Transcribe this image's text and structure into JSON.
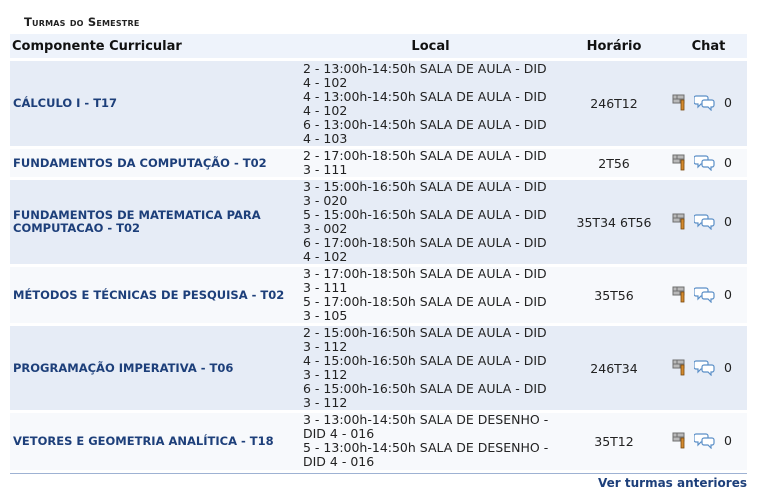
{
  "section_title": "Turmas do Semestre",
  "headers": {
    "componente": "Componente Curricular",
    "local": "Local",
    "horario": "Horário",
    "chat": "Chat"
  },
  "rows": [
    {
      "componente": "CÁLCULO I - T17",
      "local": [
        "2 - 13:00h-14:50h SALA DE AULA - DID",
        "4 - 102",
        "4 - 13:00h-14:50h SALA DE AULA - DID",
        "4 - 102",
        "6 - 13:00h-14:50h SALA DE AULA - DID",
        "4 - 103"
      ],
      "horario": "246T12",
      "chat_count": "0"
    },
    {
      "componente": "FUNDAMENTOS DA COMPUTAÇÃO - T02",
      "local": [
        "2 - 17:00h-18:50h SALA DE AULA - DID",
        "3 - 111"
      ],
      "horario": "2T56",
      "chat_count": "0"
    },
    {
      "componente": "FUNDAMENTOS DE MATEMATICA PARA COMPUTACAO - T02",
      "local": [
        "3 - 15:00h-16:50h SALA DE AULA - DID",
        "3 - 020",
        "5 - 15:00h-16:50h SALA DE AULA - DID",
        "3 - 002",
        "6 - 17:00h-18:50h SALA DE AULA - DID",
        "4 - 102"
      ],
      "horario": "35T34 6T56",
      "chat_count": "0"
    },
    {
      "componente": "MÉTODOS E TÉCNICAS DE PESQUISA - T02",
      "local": [
        "3 - 17:00h-18:50h SALA DE AULA - DID",
        "3 - 111",
        "5 - 17:00h-18:50h SALA DE AULA - DID",
        "3 - 105"
      ],
      "horario": "35T56",
      "chat_count": "0"
    },
    {
      "componente": "PROGRAMAÇÃO IMPERATIVA - T06",
      "local": [
        "2 - 15:00h-16:50h SALA DE AULA - DID",
        "3 - 112",
        "4 - 15:00h-16:50h SALA DE AULA - DID",
        "3 - 112",
        "6 - 15:00h-16:50h SALA DE AULA - DID",
        "3 - 112"
      ],
      "horario": "246T34",
      "chat_count": "0"
    },
    {
      "componente": "VETORES E GEOMETRIA ANALÍTICA - T18",
      "local": [
        "3 - 13:00h-14:50h SALA DE DESENHO -",
        "DID 4 - 016",
        "5 - 13:00h-14:50h SALA DE DESENHO -",
        "DID 4 - 016"
      ],
      "horario": "35T12",
      "chat_count": "0"
    }
  ],
  "row_icons": [
    "wall-icon",
    "chat-bubbles-icon"
  ],
  "footer_link": "Ver turmas anteriores",
  "colors": {
    "link": "#1d3f7a",
    "header_bg": "#eef3fb",
    "row_odd": "#e6ecf6",
    "row_even": "#f7f9fc"
  }
}
